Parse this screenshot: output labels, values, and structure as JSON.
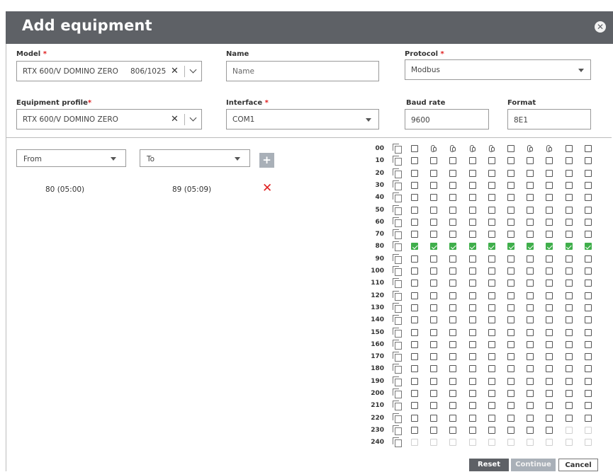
{
  "dialog": {
    "title": "Add equipment",
    "close_icon": "close-circle-icon"
  },
  "form": {
    "model": {
      "label": "Model",
      "required": "*",
      "value": "RTX 600/V DOMINO ZERO",
      "id_value": "806/1025"
    },
    "name": {
      "label": "Name",
      "placeholder": "Name"
    },
    "protocol": {
      "label": "Protocol",
      "required": "*",
      "value": "Modbus"
    },
    "profile": {
      "label": "Equipment profile",
      "required": "*",
      "value": "RTX 600/V DOMINO ZERO"
    },
    "interface": {
      "label": "Interface",
      "required": "*",
      "value": "COM1"
    },
    "baud": {
      "label": "Baud rate",
      "value": "9600"
    },
    "format": {
      "label": "Format",
      "value": "8E1"
    }
  },
  "range_picker": {
    "from_placeholder": "From",
    "to_placeholder": "To",
    "add_icon": "plus-icon",
    "ranges": [
      {
        "from": "80 (05:00)",
        "to": "89 (05:09)",
        "delete_icon": "close-red-icon"
      }
    ]
  },
  "register_grid": {
    "rows": [
      "00",
      "10",
      "20",
      "30",
      "40",
      "50",
      "60",
      "70",
      "80",
      "90",
      "100",
      "110",
      "120",
      "130",
      "140",
      "150",
      "160",
      "170",
      "180",
      "190",
      "200",
      "210",
      "220",
      "230",
      "240"
    ],
    "columns": 10,
    "linked_cells_row_00": [
      1,
      2,
      3,
      4,
      6,
      7
    ],
    "checked_row": "80",
    "disabled_from_row_230_col": 8,
    "row_icon": "copy-row-icon"
  },
  "buttons": {
    "reset": "Reset",
    "continue": "Continue",
    "cancel": "Cancel"
  }
}
